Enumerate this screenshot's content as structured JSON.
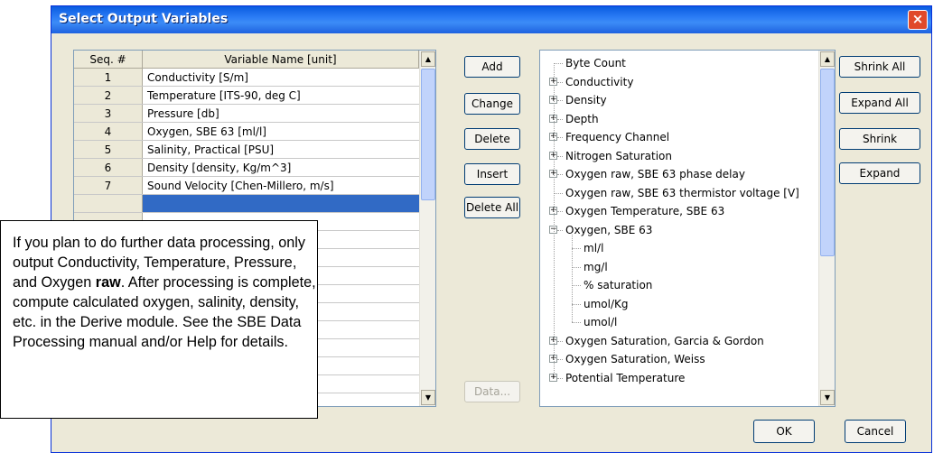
{
  "dialog": {
    "title": "Select Output Variables",
    "close_icon": "×"
  },
  "table": {
    "headers": {
      "seq": "Seq. #",
      "variable": "Variable Name [unit]"
    },
    "rows": [
      {
        "seq": "1",
        "name": "Conductivity [S/m]"
      },
      {
        "seq": "2",
        "name": "Temperature [ITS-90, deg C]"
      },
      {
        "seq": "3",
        "name": "Pressure [db]"
      },
      {
        "seq": "4",
        "name": "Oxygen, SBE 63 [ml/l]"
      },
      {
        "seq": "5",
        "name": "Salinity, Practical [PSU]"
      },
      {
        "seq": "6",
        "name": "Density [density, Kg/m^3]"
      },
      {
        "seq": "7",
        "name": "Sound Velocity [Chen-Millero, m/s]"
      },
      {
        "seq": "",
        "name": ""
      },
      {
        "seq": "",
        "name": ""
      },
      {
        "seq": "",
        "name": ""
      },
      {
        "seq": "",
        "name": ""
      },
      {
        "seq": "",
        "name": ""
      },
      {
        "seq": "",
        "name": ""
      },
      {
        "seq": "",
        "name": ""
      },
      {
        "seq": "",
        "name": ""
      },
      {
        "seq": "",
        "name": ""
      },
      {
        "seq": "",
        "name": ""
      },
      {
        "seq": "",
        "name": ""
      },
      {
        "seq": "",
        "name": ""
      }
    ]
  },
  "buttons": {
    "add": "Add",
    "change": "Change",
    "delete": "Delete",
    "insert": "Insert",
    "delete_all": "Delete All",
    "data": "Data...",
    "shrink_all": "Shrink All",
    "expand_all": "Expand All",
    "shrink": "Shrink",
    "expand": "Expand",
    "ok": "OK",
    "cancel": "Cancel"
  },
  "tree": {
    "items": [
      {
        "label": "Byte Count",
        "level": 0,
        "expander": ""
      },
      {
        "label": "Conductivity",
        "level": 0,
        "expander": "+"
      },
      {
        "label": "Density",
        "level": 0,
        "expander": "+"
      },
      {
        "label": "Depth",
        "level": 0,
        "expander": "+"
      },
      {
        "label": "Frequency Channel",
        "level": 0,
        "expander": "+"
      },
      {
        "label": "Nitrogen Saturation",
        "level": 0,
        "expander": "+"
      },
      {
        "label": "Oxygen raw, SBE 63 phase delay",
        "level": 0,
        "expander": "+"
      },
      {
        "label": "Oxygen raw, SBE 63 thermistor voltage [V]",
        "level": 0,
        "expander": ""
      },
      {
        "label": "Oxygen Temperature, SBE 63",
        "level": 0,
        "expander": "+"
      },
      {
        "label": "Oxygen, SBE 63",
        "level": 0,
        "expander": "-"
      },
      {
        "label": "ml/l",
        "level": 1,
        "expander": ""
      },
      {
        "label": "mg/l",
        "level": 1,
        "expander": ""
      },
      {
        "label": "% saturation",
        "level": 1,
        "expander": ""
      },
      {
        "label": "umol/Kg",
        "level": 1,
        "expander": ""
      },
      {
        "label": "umol/l",
        "level": 1,
        "expander": ""
      },
      {
        "label": "Oxygen Saturation, Garcia & Gordon",
        "level": 0,
        "expander": "+"
      },
      {
        "label": "Oxygen Saturation, Weiss",
        "level": 0,
        "expander": "+"
      },
      {
        "label": "Potential Temperature",
        "level": 0,
        "expander": "+"
      }
    ]
  },
  "callout": {
    "text_before_bold": "If you plan to do further data processing, only output Conductivity, Temperature, Pressure, and Oxygen ",
    "bold_text": "raw",
    "text_after_bold": ". After processing is complete, compute calculated oxygen, salinity, density, etc. in the Derive module. See the SBE Data Processing manual and/or Help for details."
  },
  "colors": {
    "title_bar": "#2b7cf5",
    "dialog_bg": "#ece9d8",
    "selection": "#316ac5",
    "close_button": "#e04a2a"
  },
  "icons": {
    "close": "close-icon",
    "scroll_up": "scroll-up-arrow-icon",
    "scroll_down": "scroll-down-arrow-icon",
    "tree_expand": "plus-expander-icon",
    "tree_collapse": "minus-expander-icon"
  }
}
